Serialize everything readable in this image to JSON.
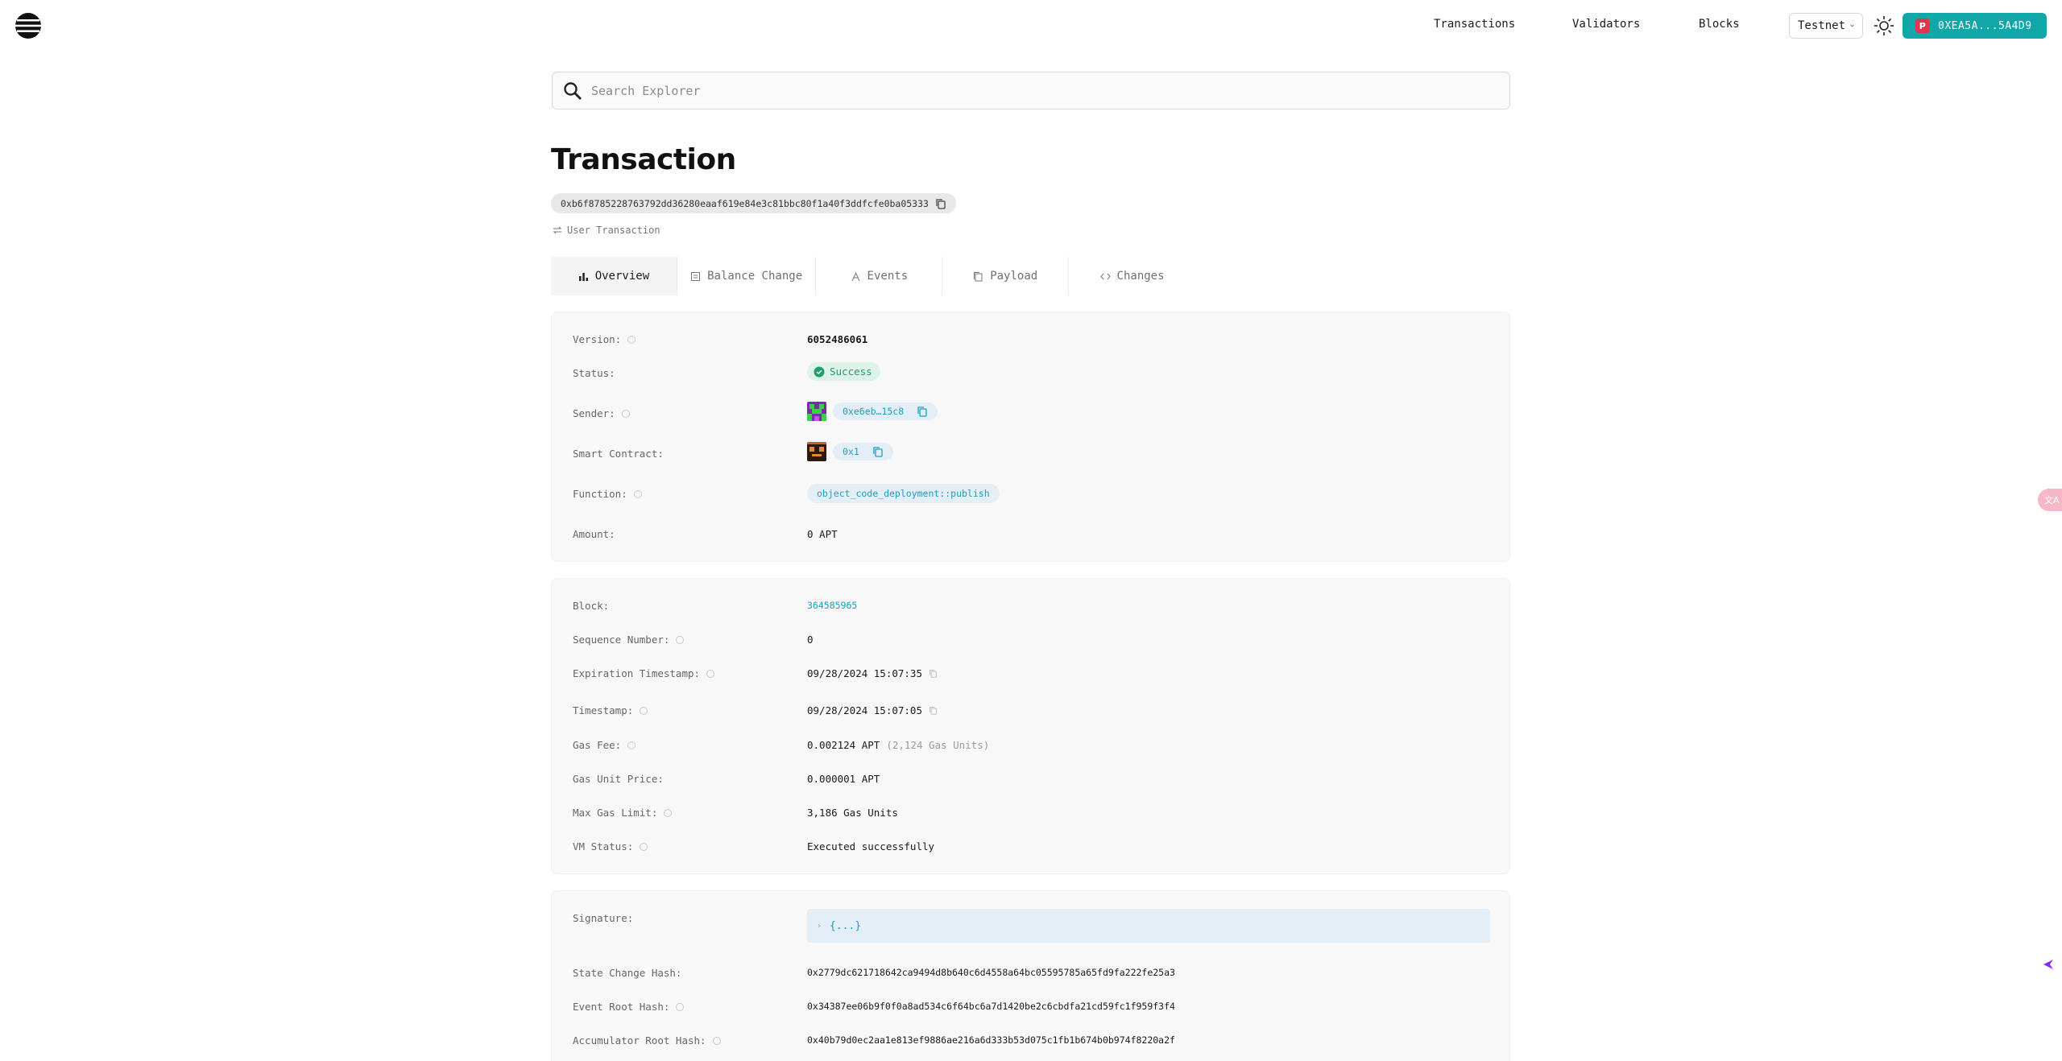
{
  "header": {
    "nav": [
      "Transactions",
      "Validators",
      "Blocks"
    ],
    "network": "Testnet",
    "wallet": "0XEA5A...5A4D9"
  },
  "search": {
    "placeholder": "Search Explorer"
  },
  "page": {
    "title": "Transaction",
    "hash": "0xb6f8785228763792dd36280eaaf619e84e3c81bbc80f1a40f3ddfcfe0ba05333",
    "type": "User Transaction"
  },
  "tabs": [
    "Overview",
    "Balance Change",
    "Events",
    "Payload",
    "Changes"
  ],
  "overview": {
    "version_label": "Version:",
    "version": "6052486061",
    "status_label": "Status:",
    "status": "Success",
    "sender_label": "Sender:",
    "sender": "0xe6eb…15c8",
    "contract_label": "Smart Contract:",
    "contract": "0x1",
    "function_label": "Function:",
    "function": "object_code_deployment::publish",
    "amount_label": "Amount:",
    "amount": "0 APT"
  },
  "details": {
    "block_label": "Block:",
    "block": "364585965",
    "seq_label": "Sequence Number:",
    "seq": "0",
    "exp_label": "Expiration Timestamp:",
    "exp": "09/28/2024 15:07:35",
    "ts_label": "Timestamp:",
    "ts": "09/28/2024 15:07:05",
    "gas_fee_label": "Gas Fee:",
    "gas_fee": "0.002124 APT",
    "gas_units": "(2,124 Gas Units)",
    "gas_price_label": "Gas Unit Price:",
    "gas_price": "0.000001 APT",
    "max_gas_label": "Max Gas Limit:",
    "max_gas": "3,186 Gas Units",
    "vm_label": "VM Status:",
    "vm": "Executed successfully"
  },
  "hashes": {
    "sig_label": "Signature:",
    "sig": "{...}",
    "state_label": "State Change Hash:",
    "state": "0x2779dc621718642ca9494d8b640c6d4558a64bc05595785a65fd9fa222fe25a3",
    "event_label": "Event Root Hash:",
    "event": "0x34387ee06b9f0f0a8ad534c6f64bc6a7d1420be2c6cbdfa21cd59fc1f959f3f4",
    "acc_label": "Accumulator Root Hash:",
    "acc": "0x40b79d0ec2aa1e813ef9886ae216a6d333b53d075c1fb1b674b0b974f8220a2f"
  },
  "colors": {
    "accent": "#11a7a9",
    "link": "#1aa0c0",
    "success": "#1e9e6a"
  }
}
